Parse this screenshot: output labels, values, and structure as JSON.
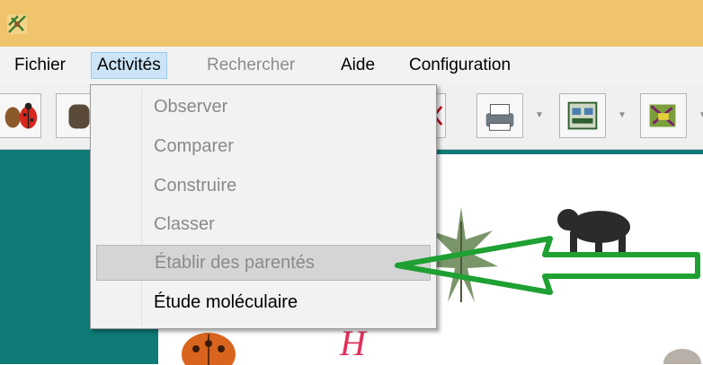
{
  "menubar": {
    "items": [
      {
        "label": "Fichier",
        "enabled": true
      },
      {
        "label": "Activités",
        "enabled": true,
        "open": true
      },
      {
        "label": "Rechercher",
        "enabled": false
      },
      {
        "label": "Aide",
        "enabled": true
      },
      {
        "label": "Configuration",
        "enabled": true
      }
    ]
  },
  "activites_menu": {
    "items": [
      {
        "label": "Observer",
        "enabled": false
      },
      {
        "label": "Comparer",
        "enabled": false
      },
      {
        "label": "Construire",
        "enabled": false
      },
      {
        "label": "Classer",
        "enabled": false
      },
      {
        "label": "Établir des parentés",
        "enabled": false,
        "highlighted": true
      },
      {
        "label": "Étude moléculaire",
        "enabled": true
      }
    ]
  },
  "content": {
    "letter_label": "H"
  },
  "colors": {
    "titlebar": "#f0c46a",
    "teal_background": "#0e7b76",
    "annotation_arrow": "#1fa032",
    "letter_label": "#e0305a"
  },
  "icons": [
    "app-icon",
    "ladybug-icon",
    "printer-icon",
    "card-icon",
    "tree-icon"
  ]
}
